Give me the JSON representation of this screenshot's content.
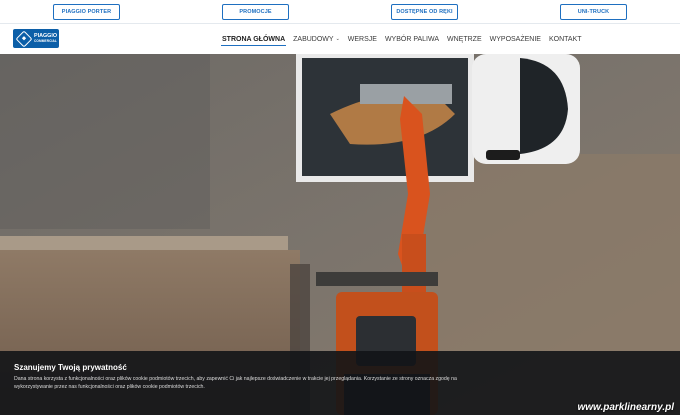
{
  "topbar": {
    "links": [
      "PIAGGIO PORTER",
      "PROMOCJE",
      "DOSTĘPNE OD RĘKI",
      "UNI-TRUCK"
    ]
  },
  "nav": {
    "logo": {
      "line1": "PIAGGIO",
      "line2": "COMMERCIAL"
    },
    "items": [
      "STRONA GŁÓWNA",
      "ZABUDOWY",
      "WERSJE",
      "WYBÓR PALIWA",
      "WNĘTRZE",
      "WYPOSAŻENIE",
      "KONTAKT"
    ],
    "active_index": 0,
    "caret": "⌄"
  },
  "cookie": {
    "title": "Szanujemy Twoją prywatność",
    "text": "Dana strona korzysta z funkcjonalności oraz plików cookie podmiotów trzecich, aby zapewnić Ci jak najlepsze doświadczenie w trakcie jej przeglądania. Korzystanie ze strony oznacza zgodę na wykorzystywanie przez nas funkcjonalności oraz plików cookie podmiotów trzecich."
  },
  "watermark": "www.parklinearny.pl",
  "colors": {
    "brand_blue": "#1e6fc0",
    "logo_blue": "#0c5fa8",
    "excavator_orange": "#d9531e"
  }
}
